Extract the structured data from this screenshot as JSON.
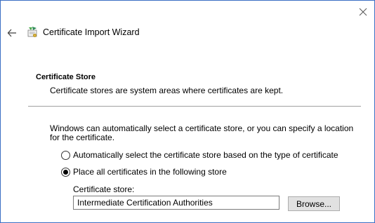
{
  "window": {
    "title": "Certificate Import Wizard",
    "close_glyph": "✕",
    "back_glyph": "←",
    "title_icon": "certificate-wizard-icon",
    "border_color": "#3b6fc4"
  },
  "section": {
    "heading": "Certificate Store",
    "description": "Certificate stores are system areas where certificates are kept."
  },
  "intro": "Windows can automatically select a certificate store, or you can specify a location for the certificate.",
  "options": [
    {
      "label": "Automatically select the certificate store based on the type of certificate",
      "selected": false
    },
    {
      "label": "Place all certificates in the following store",
      "selected": true
    }
  ],
  "store": {
    "label": "Certificate store:",
    "value": "Intermediate Certification Authorities",
    "browse_label": "Browse..."
  }
}
